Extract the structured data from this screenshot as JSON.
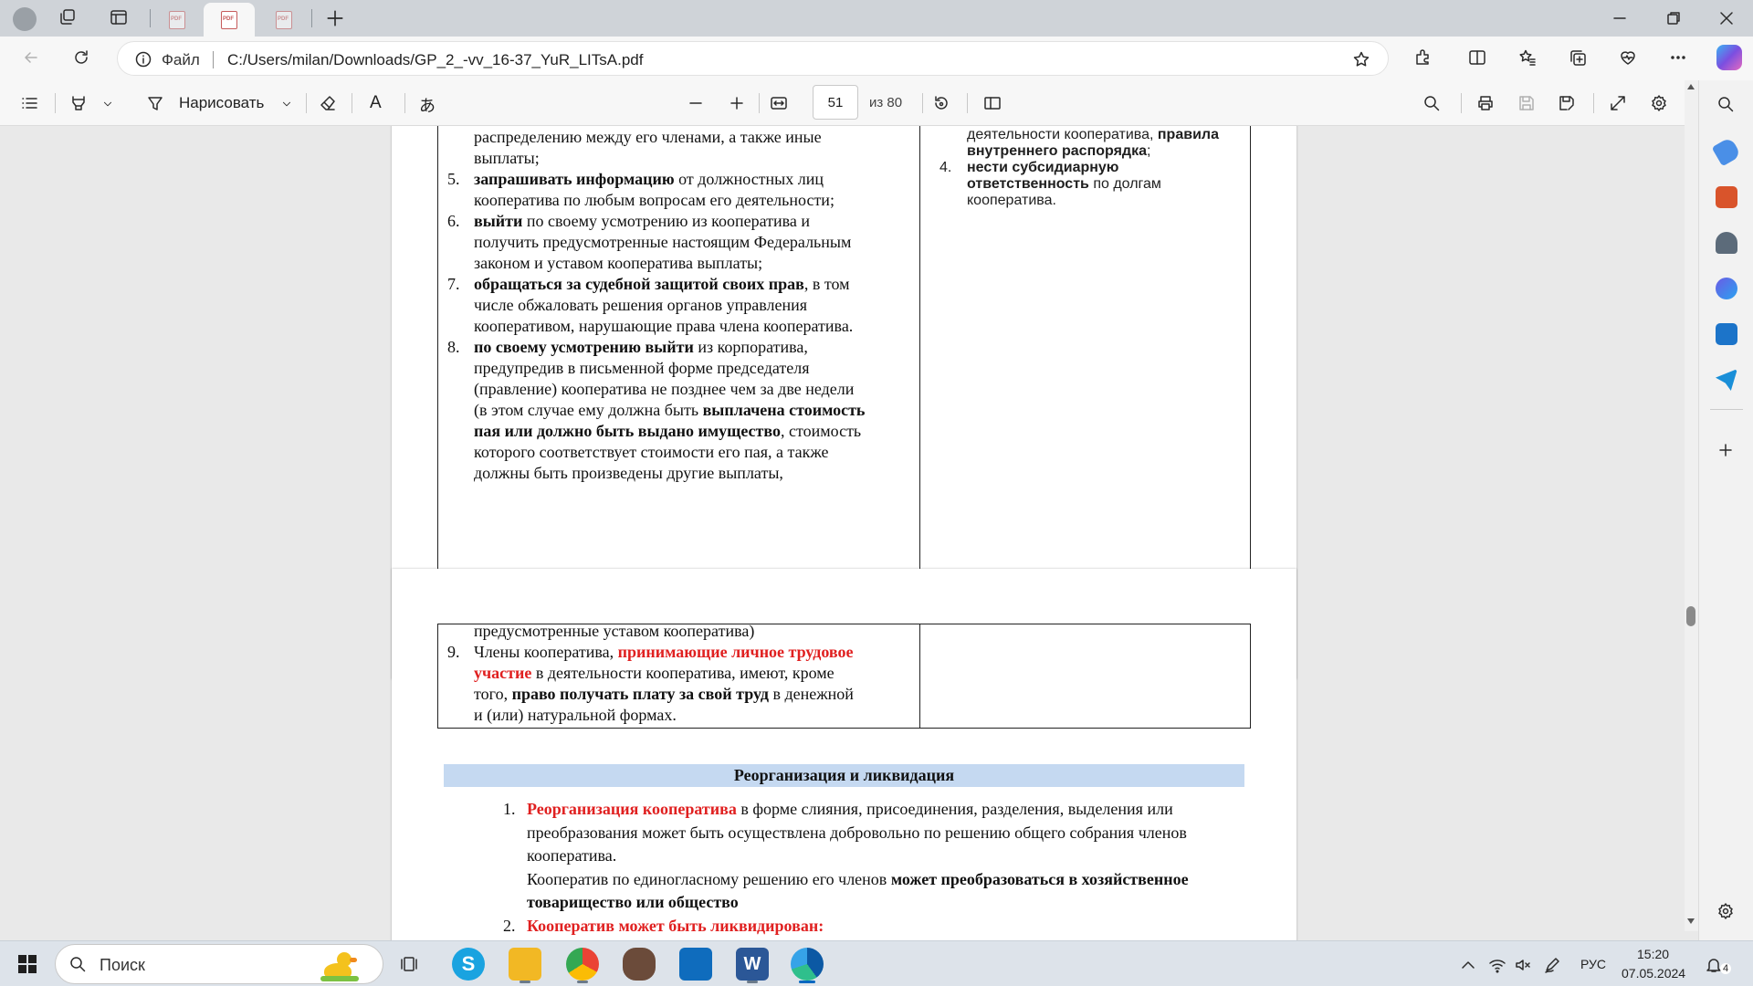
{
  "browser": {
    "address": {
      "scheme_label": "Файл",
      "url": "C:/Users/milan/Downloads/GP_2_-vv_16-37_YuR_LITsA.pdf"
    }
  },
  "pdf_toolbar": {
    "draw_label": "Нарисовать",
    "font_glyph": "A",
    "translate_glyph": "あ",
    "page_current": "51",
    "page_total": "из 80"
  },
  "page51": {
    "left_top_lines": [
      "распределению между его членами, а также иные",
      "выплаты;"
    ],
    "left_items": [
      {
        "num": "5.",
        "lines": [
          [
            {
              "t": "запрашивать информацию",
              "b": true
            },
            {
              "t": " от должностных лиц"
            }
          ],
          [
            {
              "t": "кооператива по любым вопросам его деятельности;"
            }
          ]
        ]
      },
      {
        "num": "6.",
        "lines": [
          [
            {
              "t": "выйти",
              "b": true
            },
            {
              "t": " по своему усмотрению из кооператива и"
            }
          ],
          [
            {
              "t": "получить предусмотренные настоящим Федеральным"
            }
          ],
          [
            {
              "t": "законом и уставом кооператива выплаты;"
            }
          ]
        ]
      },
      {
        "num": "7.",
        "lines": [
          [
            {
              "t": "обращаться за судебной защитой своих прав",
              "b": true
            },
            {
              "t": ", в том"
            }
          ],
          [
            {
              "t": "числе обжаловать решения органов управления"
            }
          ],
          [
            {
              "t": "кооперативом, нарушающие права члена кооператива."
            }
          ]
        ]
      },
      {
        "num": "8.",
        "lines": [
          [
            {
              "t": "по своему усмотрению выйти",
              "b": true
            },
            {
              "t": " из корпоратива,"
            }
          ],
          [
            {
              "t": "предупредив в письменной форме председателя"
            }
          ],
          [
            {
              "t": "(правление) кооператива не позднее чем за две недели"
            }
          ],
          [
            {
              "t": "(в этом случае ему должна быть "
            },
            {
              "t": "выплачена стоимость",
              "b": true
            }
          ],
          [
            {
              "t": "пая или должно быть выдано имущество",
              "b": true
            },
            {
              "t": ", стоимость"
            }
          ],
          [
            {
              "t": "которого соответствует стоимости его пая, а также"
            }
          ],
          [
            {
              "t": "должны быть произведены другие выплаты,"
            }
          ]
        ]
      }
    ],
    "right_lines": [
      [
        {
          "t": "деятельности кооператива, "
        },
        {
          "t": "правила",
          "b": true
        }
      ],
      [
        {
          "t": "внутреннего распорядка",
          "b": true
        },
        {
          "t": ";"
        }
      ]
    ],
    "right_items": [
      {
        "num": "4.",
        "lines": [
          [
            {
              "t": "нести субсидиарную",
              "b": true
            }
          ],
          [
            {
              "t": "ответственность",
              "b": true
            },
            {
              "t": " по долгам"
            }
          ],
          [
            {
              "t": "кооператива."
            }
          ]
        ]
      }
    ],
    "page_number": "51"
  },
  "page52": {
    "top_line": "предусмотренные уставом кооператива)",
    "item9": {
      "num": "9.",
      "lines": [
        [
          {
            "t": "Члены кооператива, "
          },
          {
            "t": "принимающие личное трудовое",
            "b": true,
            "r": true
          }
        ],
        [
          {
            "t": "участие",
            "b": true,
            "r": true
          },
          {
            "t": " в деятельности кооператива, имеют, кроме"
          }
        ],
        [
          {
            "t": "того, "
          },
          {
            "t": "право получать плату за свой труд",
            "b": true
          },
          {
            "t": " в денежной"
          }
        ],
        [
          {
            "t": "и (или) натуральной формах."
          }
        ]
      ]
    },
    "section_title": "Реорганизация и ликвидация",
    "section_items": [
      {
        "num": "1.",
        "lines": [
          [
            {
              "t": "Реорганизация кооператива",
              "b": true,
              "r": true
            },
            {
              "t": " в форме слияния, присоединения, разделения, выделения или"
            }
          ],
          [
            {
              "t": "преобразования может быть осуществлена добровольно по решению общего собрания членов"
            }
          ],
          [
            {
              "t": "кооператива."
            }
          ],
          [
            {
              "t": "Кооператив по единогласному решению его членов "
            },
            {
              "t": "может преобразоваться в хозяйственное",
              "b": true
            }
          ],
          [
            {
              "t": "товарищество или общество",
              "b": true
            }
          ]
        ]
      },
      {
        "num": "2.",
        "lines": [
          [
            {
              "t": "Кооператив может быть ликвидирован:",
              "b": true,
              "r": true
            }
          ]
        ]
      }
    ]
  },
  "taskbar": {
    "search_label": "Поиск",
    "lang": "РУС",
    "time": "15:20",
    "date": "07.05.2024",
    "notifications": "4"
  },
  "colors": {
    "accent_red": "#e02020",
    "section_band": "#c5d9f1",
    "edge_blue": "#0c59a4"
  }
}
